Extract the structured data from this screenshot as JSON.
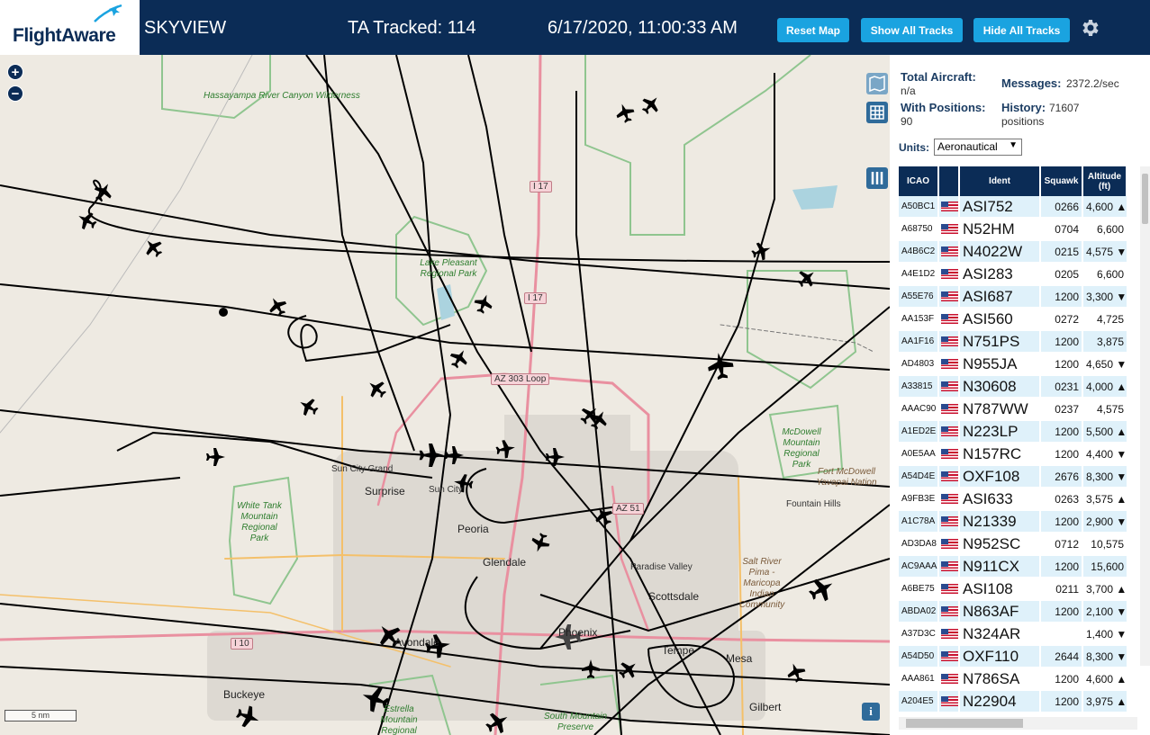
{
  "header": {
    "logo": "FlightAware",
    "app_title": "SKYVIEW",
    "tracked_label": "TA Tracked: 114",
    "datetime": "6/17/2020, 11:00:33 AM",
    "buttons": {
      "reset_map": "Reset Map",
      "show_all_tracks": "Show All Tracks",
      "hide_all_tracks": "Hide All Tracks"
    },
    "settings_icon": "gear-icon"
  },
  "map": {
    "zoom_in": "+",
    "zoom_out": "−",
    "scale": "5 nm",
    "info": "i",
    "labels": {
      "hassayampa": "Hassayampa River Canyon Wilderness",
      "lake_pleasant": "Lake Pleasant Regional Park",
      "white_tank": "White Tank Mountain Regional Park",
      "mcdowell": "McDowell Mountain Regional Park",
      "fort_mcdowell": "Fort McDowell Yavapai Nation",
      "salt_river": "Salt River Pima - Maricopa Indian Community",
      "estrella": "Estrella Mountain Regional",
      "south_mountain": "South Mountain Preserve",
      "sun_city_grand": "Sun City Grand",
      "surprise": "Surprise",
      "sun_city": "Sun City",
      "peoria": "Peoria",
      "glendale": "Glendale",
      "paradise_valley": "Paradise Valley",
      "scottsdale": "Scottsdale",
      "fountain_hills": "Fountain Hills",
      "phoenix": "Phoenix",
      "tempe": "Tempe",
      "mesa": "Mesa",
      "gilbert": "Gilbert",
      "buckeye": "Buckeye",
      "avondale": "Avondale",
      "i17_a": "I 17",
      "i17_b": "I 17",
      "az303": "AZ 303 Loop",
      "az51": "AZ 51",
      "i10": "I 10"
    }
  },
  "stats": {
    "total_aircraft_label": "Total Aircraft:",
    "total_aircraft_value": "n/a",
    "with_positions_label": "With Positions:",
    "with_positions_value": "90",
    "messages_label": "Messages:",
    "messages_value": "2372.2/sec",
    "history_label": "History:",
    "history_value": "71607",
    "history_unit": "positions",
    "units_label": "Units:",
    "units_value": "Aeronautical"
  },
  "table": {
    "headers": {
      "icao": "ICAO",
      "ident": "Ident",
      "squawk": "Squawk",
      "altitude": "Altitude (ft)"
    },
    "rows": [
      {
        "icao": "A50BC1",
        "ident": "ASI752",
        "squawk": "0266",
        "altitude": "4,600 ▲"
      },
      {
        "icao": "A68750",
        "ident": "N52HM",
        "squawk": "0704",
        "altitude": "6,600"
      },
      {
        "icao": "A4B6C2",
        "ident": "N4022W",
        "squawk": "0215",
        "altitude": "4,575 ▼"
      },
      {
        "icao": "A4E1D2",
        "ident": "ASI283",
        "squawk": "0205",
        "altitude": "6,600"
      },
      {
        "icao": "A55E76",
        "ident": "ASI687",
        "squawk": "1200",
        "altitude": "3,300 ▼"
      },
      {
        "icao": "AA153F",
        "ident": "ASI560",
        "squawk": "0272",
        "altitude": "4,725"
      },
      {
        "icao": "AA1F16",
        "ident": "N751PS",
        "squawk": "1200",
        "altitude": "3,875"
      },
      {
        "icao": "AD4803",
        "ident": "N955JA",
        "squawk": "1200",
        "altitude": "4,650 ▼"
      },
      {
        "icao": "A33815",
        "ident": "N30608",
        "squawk": "0231",
        "altitude": "4,000 ▲"
      },
      {
        "icao": "AAAC90",
        "ident": "N787WW",
        "squawk": "0237",
        "altitude": "4,575"
      },
      {
        "icao": "A1ED2E",
        "ident": "N223LP",
        "squawk": "1200",
        "altitude": "5,500 ▲"
      },
      {
        "icao": "A0E5AA",
        "ident": "N157RC",
        "squawk": "1200",
        "altitude": "4,400 ▼"
      },
      {
        "icao": "A54D4E",
        "ident": "OXF108",
        "squawk": "2676",
        "altitude": "8,300 ▼"
      },
      {
        "icao": "A9FB3E",
        "ident": "ASI633",
        "squawk": "0263",
        "altitude": "3,575 ▲"
      },
      {
        "icao": "A1C78A",
        "ident": "N21339",
        "squawk": "1200",
        "altitude": "2,900 ▼"
      },
      {
        "icao": "AD3DA8",
        "ident": "N952SC",
        "squawk": "0712",
        "altitude": "10,575"
      },
      {
        "icao": "AC9AAA",
        "ident": "N911CX",
        "squawk": "1200",
        "altitude": "15,600"
      },
      {
        "icao": "A6BE75",
        "ident": "ASI108",
        "squawk": "0211",
        "altitude": "3,700 ▲"
      },
      {
        "icao": "ABDA02",
        "ident": "N863AF",
        "squawk": "1200",
        "altitude": "2,100 ▼"
      },
      {
        "icao": "A37D3C",
        "ident": "N324AR",
        "squawk": "",
        "altitude": "1,400 ▼"
      },
      {
        "icao": "A54D50",
        "ident": "OXF110",
        "squawk": "2644",
        "altitude": "8,300 ▼"
      },
      {
        "icao": "AAA861",
        "ident": "N786SA",
        "squawk": "1200",
        "altitude": "4,600 ▲"
      },
      {
        "icao": "A204E5",
        "ident": "N22904",
        "squawk": "1200",
        "altitude": "3,975 ▲"
      }
    ]
  },
  "colors": {
    "header_bg": "#0b2c56",
    "button_bg": "#1aa3e0",
    "row_alt": "#dff1fa",
    "map_bg": "#eeeae2",
    "park_green": "#8fc58f",
    "track": "#000000"
  }
}
